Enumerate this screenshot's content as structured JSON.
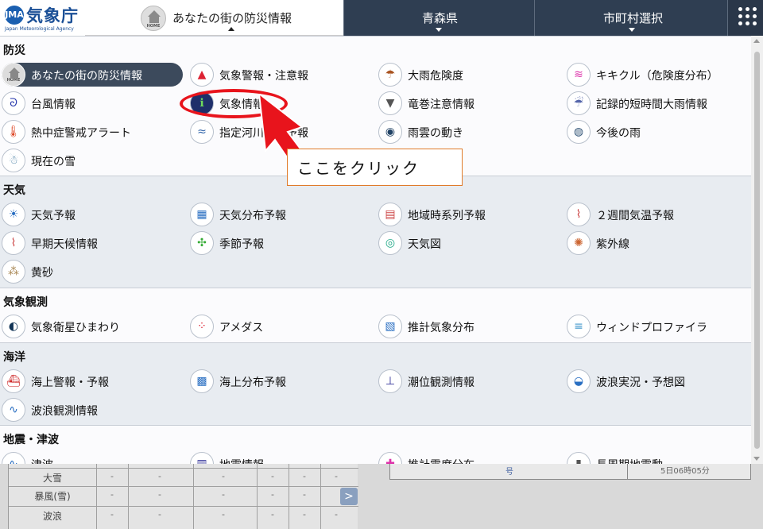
{
  "header": {
    "logo_text": "気象庁",
    "logo_mark": "JMA",
    "logo_sub": "Japan Meteorological Agency",
    "home_icon_label": "HOME",
    "tab_home_label": "あなたの街の防災情報",
    "tab_pref_label": "青森県",
    "tab_city_label": "市町村選択",
    "menu_icon": "grid-menu-icon"
  },
  "sections": {
    "bousai": {
      "title": "防災",
      "items": [
        {
          "label": "あなたの街の防災情報",
          "icon": "home-icon"
        },
        {
          "label": "気象警報・注意報",
          "icon": "warning-icon",
          "glyph": "▲"
        },
        {
          "label": "大雨危険度",
          "icon": "rain-risk-icon",
          "glyph": "☂"
        },
        {
          "label": "キキクル（危険度分布）",
          "icon": "kikikuru-icon",
          "glyph": "≋"
        },
        {
          "label": "台風情報",
          "icon": "typhoon-icon",
          "glyph": "ᘐ"
        },
        {
          "label": "気象情報",
          "icon": "weather-info-icon",
          "glyph": "ℹ"
        },
        {
          "label": "竜巻注意情報",
          "icon": "tornado-icon",
          "glyph": "▼"
        },
        {
          "label": "記録的短時間大雨情報",
          "icon": "heavy-rain-icon",
          "glyph": "☔"
        },
        {
          "label": "熱中症警戒アラート",
          "icon": "heatstroke-icon",
          "glyph": "🌡"
        },
        {
          "label": "指定河川洪水予報",
          "icon": "river-flood-icon",
          "glyph": "≈"
        },
        {
          "label": "雨雲の動き",
          "icon": "rain-cloud-icon",
          "glyph": "◉"
        },
        {
          "label": "今後の雨",
          "icon": "future-rain-icon",
          "glyph": "◍"
        },
        {
          "label": "現在の雪",
          "icon": "snow-icon",
          "glyph": "☃"
        }
      ]
    },
    "tenki": {
      "title": "天気",
      "items": [
        {
          "label": "天気予報",
          "icon": "forecast-icon",
          "glyph": "☀"
        },
        {
          "label": "天気分布予報",
          "icon": "weather-map-icon",
          "glyph": "▦"
        },
        {
          "label": "地域時系列予報",
          "icon": "time-series-icon",
          "glyph": "▤"
        },
        {
          "label": "２週間気温予報",
          "icon": "two-week-temp-icon",
          "glyph": "⌇"
        },
        {
          "label": "早期天候情報",
          "icon": "early-weather-icon",
          "glyph": "⌇"
        },
        {
          "label": "季節予報",
          "icon": "season-icon",
          "glyph": "✣"
        },
        {
          "label": "天気図",
          "icon": "weather-chart-icon",
          "glyph": "◎"
        },
        {
          "label": "紫外線",
          "icon": "uv-icon",
          "glyph": "✺"
        },
        {
          "label": "黄砂",
          "icon": "yellow-sand-icon",
          "glyph": "⁂"
        }
      ]
    },
    "kansoku": {
      "title": "気象観測",
      "items": [
        {
          "label": "気象衛星ひまわり",
          "icon": "satellite-icon",
          "glyph": "◐"
        },
        {
          "label": "アメダス",
          "icon": "amedas-icon",
          "glyph": "⁘"
        },
        {
          "label": "推計気象分布",
          "icon": "estimated-weather-icon",
          "glyph": "▧"
        },
        {
          "label": "ウィンドプロファイラ",
          "icon": "wind-profiler-icon",
          "glyph": "≡"
        }
      ]
    },
    "kaiyo": {
      "title": "海洋",
      "items": [
        {
          "label": "海上警報・予報",
          "icon": "marine-warning-icon",
          "glyph": "⛴"
        },
        {
          "label": "海上分布予報",
          "icon": "marine-map-icon",
          "glyph": "▩"
        },
        {
          "label": "潮位観測情報",
          "icon": "tide-icon",
          "glyph": "⊥"
        },
        {
          "label": "波浪実況・予想図",
          "icon": "wave-chart-icon",
          "glyph": "◒"
        },
        {
          "label": "波浪観測情報",
          "icon": "wave-observation-icon",
          "glyph": "∿"
        }
      ]
    },
    "jishin": {
      "title": "地震・津波",
      "items": [
        {
          "label": "津波",
          "icon": "tsunami-icon",
          "glyph": "∿"
        },
        {
          "label": "地震情報",
          "icon": "earthquake-icon",
          "glyph": "▥"
        },
        {
          "label": "推計震度分布",
          "icon": "intensity-icon",
          "glyph": "✚"
        },
        {
          "label": "長周期地震動",
          "icon": "long-period-icon",
          "glyph": "▮"
        }
      ]
    }
  },
  "annotation": {
    "callout_text": "ここをクリック",
    "ring_color": "#e8141c",
    "arrow_color": "#e8141c"
  },
  "background_page": {
    "rows": [
      "大雪",
      "暴風(雪)",
      "波浪"
    ],
    "dash": "-",
    "next_glyph": ">",
    "right_text_1": "号",
    "right_text_2": "5日06時05分"
  },
  "colors": {
    "header_bg": "#2f3e52",
    "active_item_bg": "#3c4a5c",
    "section_gray": "#e8ecf1"
  }
}
